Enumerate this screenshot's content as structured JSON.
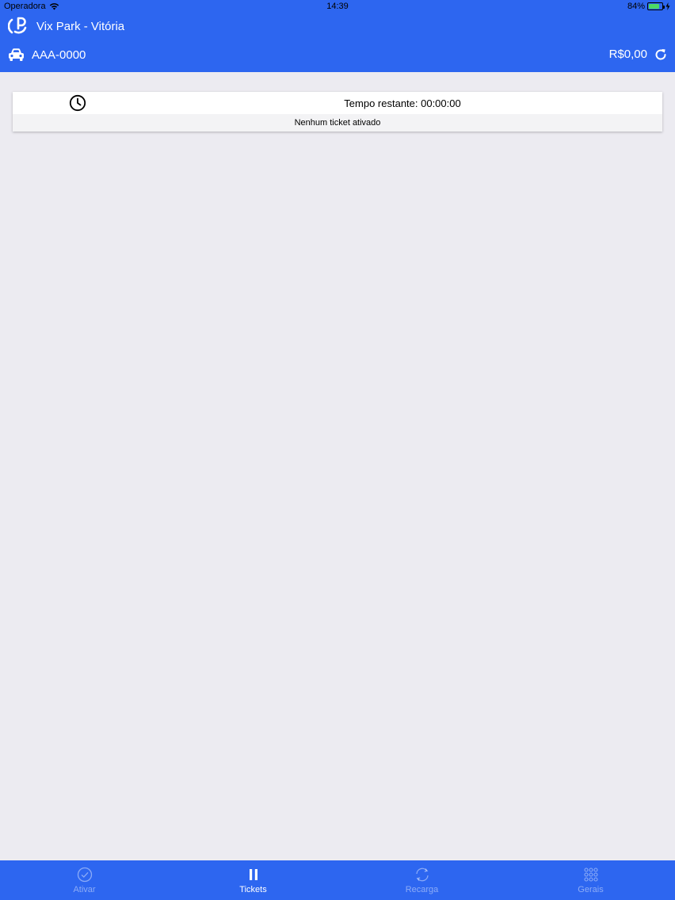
{
  "status_bar": {
    "carrier": "Operadora",
    "time": "14:39",
    "battery": "84%",
    "battery_level": 0.84
  },
  "header": {
    "app_title": "Vix Park - Vitória",
    "plate": "AAA-0000",
    "balance": "R$0,00"
  },
  "ticket": {
    "remaining_label": "Tempo restante: 00:00:00",
    "status": "Nenhum ticket ativado"
  },
  "tabs": [
    {
      "label": "Ativar",
      "icon": "check-circle-icon",
      "active": false
    },
    {
      "label": "Tickets",
      "icon": "pause-icon",
      "active": true
    },
    {
      "label": "Recarga",
      "icon": "refresh-icon",
      "active": false
    },
    {
      "label": "Gerais",
      "icon": "grid-icon",
      "active": false
    }
  ],
  "colors": {
    "primary": "#2d66f0",
    "background": "#ecebf1",
    "card": "#ffffff"
  }
}
